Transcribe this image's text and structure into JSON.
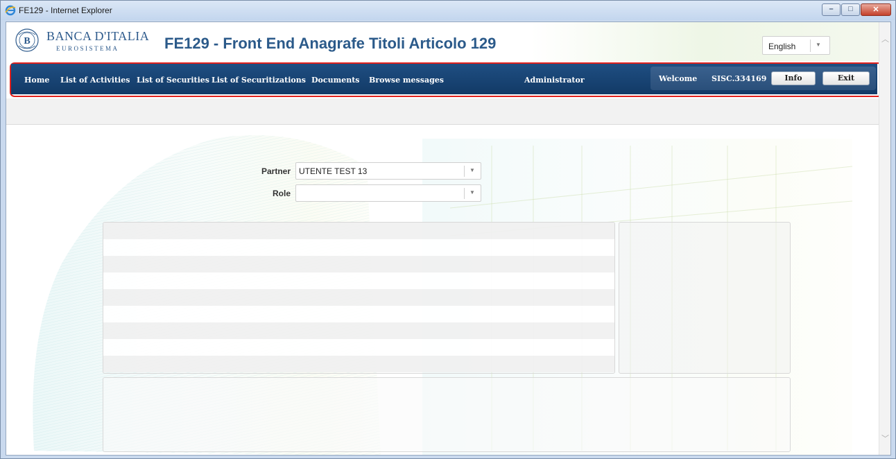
{
  "window": {
    "title": "FE129 - Internet Explorer",
    "buttons": {
      "minimize": "–",
      "maximize": "□",
      "close": "✕"
    }
  },
  "header": {
    "bank_name": "BANCA D'ITALIA",
    "bank_subtitle": "EUROSISTEMA",
    "app_title": "FE129 - Front End Anagrafe Titoli Articolo 129",
    "language": {
      "selected": "English"
    }
  },
  "nav": {
    "items": [
      {
        "label": "Home"
      },
      {
        "label": "List of Activities"
      },
      {
        "label": "List of Securities"
      },
      {
        "label": "List of Securitizations"
      },
      {
        "label": "Documents"
      },
      {
        "label": "Browse messages"
      },
      {
        "label": "Administrator"
      }
    ],
    "welcome_label": "Welcome",
    "user": "SISC.334169",
    "info_button": "Info",
    "exit_button": "Exit"
  },
  "form": {
    "partner": {
      "label": "Partner",
      "value": "UTENTE TEST 13"
    },
    "role": {
      "label": "Role",
      "value": ""
    }
  },
  "colors": {
    "brand_blue": "#2b5a8a",
    "nav_bg": "#1a4677",
    "highlight": "#e0211d"
  },
  "icons": {
    "browser": "ie-icon",
    "logo": "bank-logo",
    "dropdown": "chevron-down-icon"
  }
}
